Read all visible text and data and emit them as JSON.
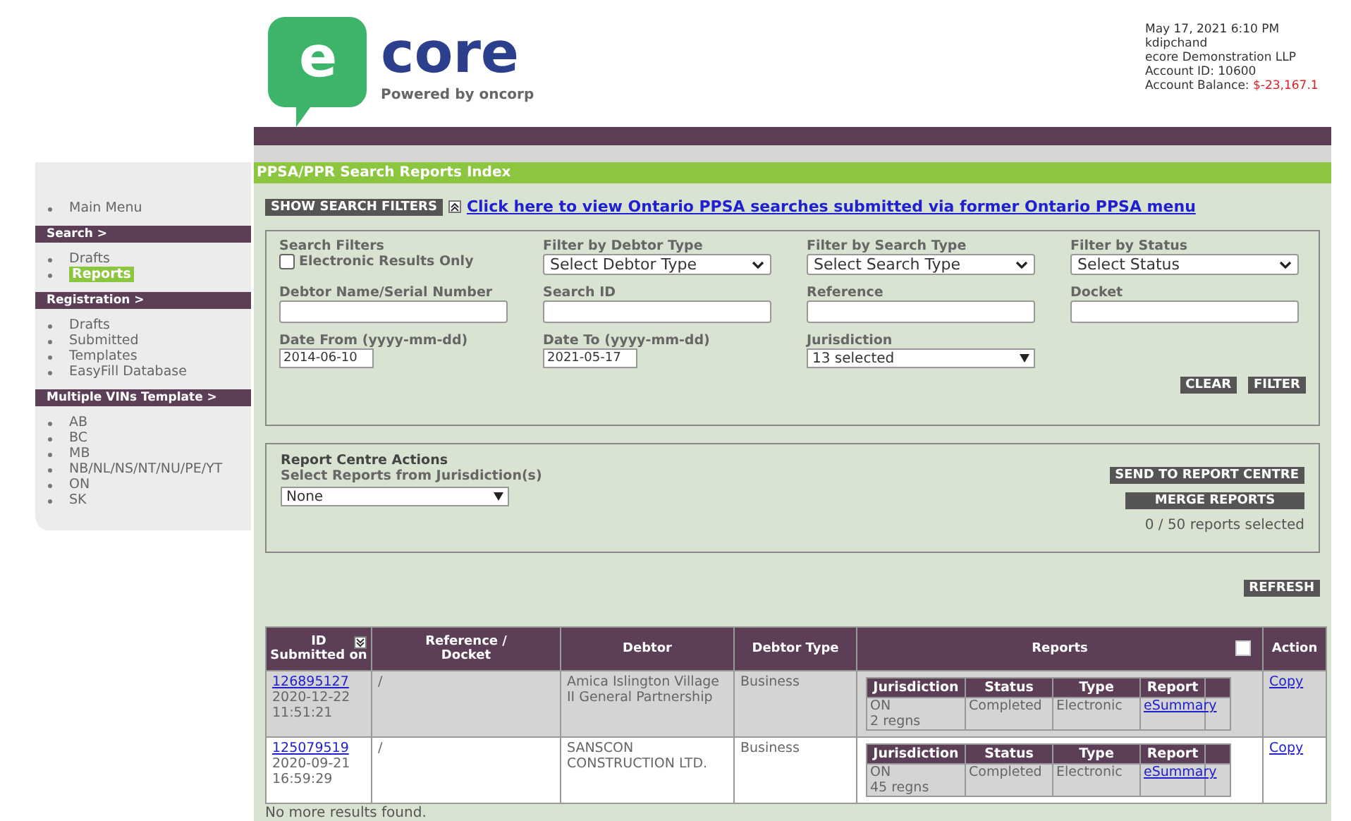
{
  "header": {
    "logo_letter": "e",
    "logo_word": "core",
    "tagline": "Powered by oncorp",
    "account": {
      "datetime": "May 17, 2021 6:10 PM",
      "user": "kdipchand",
      "company": "ecore Demonstration LLP",
      "account_id": "Account ID: 10600",
      "balance_label": "Account Balance:",
      "balance": "$-23,167.1"
    }
  },
  "sidebar": {
    "main_menu": "Main Menu",
    "sections": [
      {
        "title": "Search >",
        "items": [
          {
            "label": "Drafts",
            "selected": false
          },
          {
            "label": "Reports",
            "selected": true
          }
        ]
      },
      {
        "title": "Registration >",
        "items": [
          {
            "label": "Drafts",
            "selected": false
          },
          {
            "label": "Submitted",
            "selected": false
          },
          {
            "label": "Templates",
            "selected": false
          },
          {
            "label": "EasyFill Database",
            "selected": false
          }
        ]
      },
      {
        "title": "Multiple VINs Template >",
        "items": [
          {
            "label": "AB",
            "selected": false
          },
          {
            "label": "BC",
            "selected": false
          },
          {
            "label": "MB",
            "selected": false
          },
          {
            "label": "NB/NL/NS/NT/NU/PE/YT",
            "selected": false
          },
          {
            "label": "ON",
            "selected": false
          },
          {
            "label": "SK",
            "selected": false
          }
        ]
      }
    ]
  },
  "page_title": "PPSA/PPR Search Reports Index",
  "show_filters_button": "SHOW SEARCH FILTERS",
  "ontario_link": "Click here to view Ontario PPSA searches submitted via former Ontario PPSA menu",
  "filters": {
    "title": "Search Filters",
    "electronic_only": {
      "label": "Electronic Results Only",
      "checked": false
    },
    "fields": [
      {
        "kind": "select",
        "label": "Filter by Debtor Type",
        "value": "Select Debtor Type"
      },
      {
        "kind": "select",
        "label": "Filter by Search Type",
        "value": "Select Search Type"
      },
      {
        "kind": "select",
        "label": "Filter by Status",
        "value": "Select Status"
      },
      {
        "kind": "text",
        "label": "Debtor Name/Serial Number"
      },
      {
        "kind": "text",
        "label": "Search ID"
      },
      {
        "kind": "text",
        "label": "Reference"
      },
      {
        "kind": "text",
        "label": "Docket"
      },
      {
        "kind": "date",
        "label": "Date From (yyyy-mm-dd)",
        "value": "2014-06-10"
      },
      {
        "kind": "date",
        "label": "Date To (yyyy-mm-dd)",
        "value": "2021-05-17"
      },
      {
        "kind": "multi",
        "label": "Jurisdiction",
        "value": "13 selected"
      }
    ],
    "buttons": [
      "CLEAR",
      "FILTER"
    ]
  },
  "report_centre": {
    "title": "Report Centre Actions",
    "select_label": "Select Reports from Jurisdiction(s)",
    "select_value": "None",
    "buttons": [
      "SEND TO REPORT CENTRE",
      "MERGE REPORTS"
    ],
    "selected_count": "0 / 50 reports selected"
  },
  "refresh_button": "REFRESH",
  "table": {
    "columns": [
      "ID\nSubmitted on",
      "Reference /\nDocket",
      "Debtor",
      "Debtor Type",
      "Reports",
      "Action"
    ],
    "select_all_checked": false,
    "rows": [
      {
        "id": "126895127",
        "submitted": "2020-12-22\n11:51:21",
        "reference": "/",
        "debtor": "Amica Islington Village II General Partnership",
        "debtor_type": "Business",
        "report": {
          "columns": [
            "Jurisdiction",
            "Status",
            "Type",
            "Report"
          ],
          "jurisdiction": "ON",
          "regns": "2 regns",
          "status": "Completed",
          "type": "Electronic",
          "report": "eSummary"
        },
        "action": "Copy"
      },
      {
        "id": "125079519",
        "submitted": "2020-09-21\n16:59:29",
        "reference": "/",
        "debtor": "SANSCON CONSTRUCTION LTD.",
        "debtor_type": "Business",
        "report": {
          "columns": [
            "Jurisdiction",
            "Status",
            "Type",
            "Report"
          ],
          "jurisdiction": "ON",
          "regns": "45 regns",
          "status": "Completed",
          "type": "Electronic",
          "report": "eSummary"
        },
        "action": "Copy"
      }
    ]
  },
  "footer_text": "No more results found."
}
